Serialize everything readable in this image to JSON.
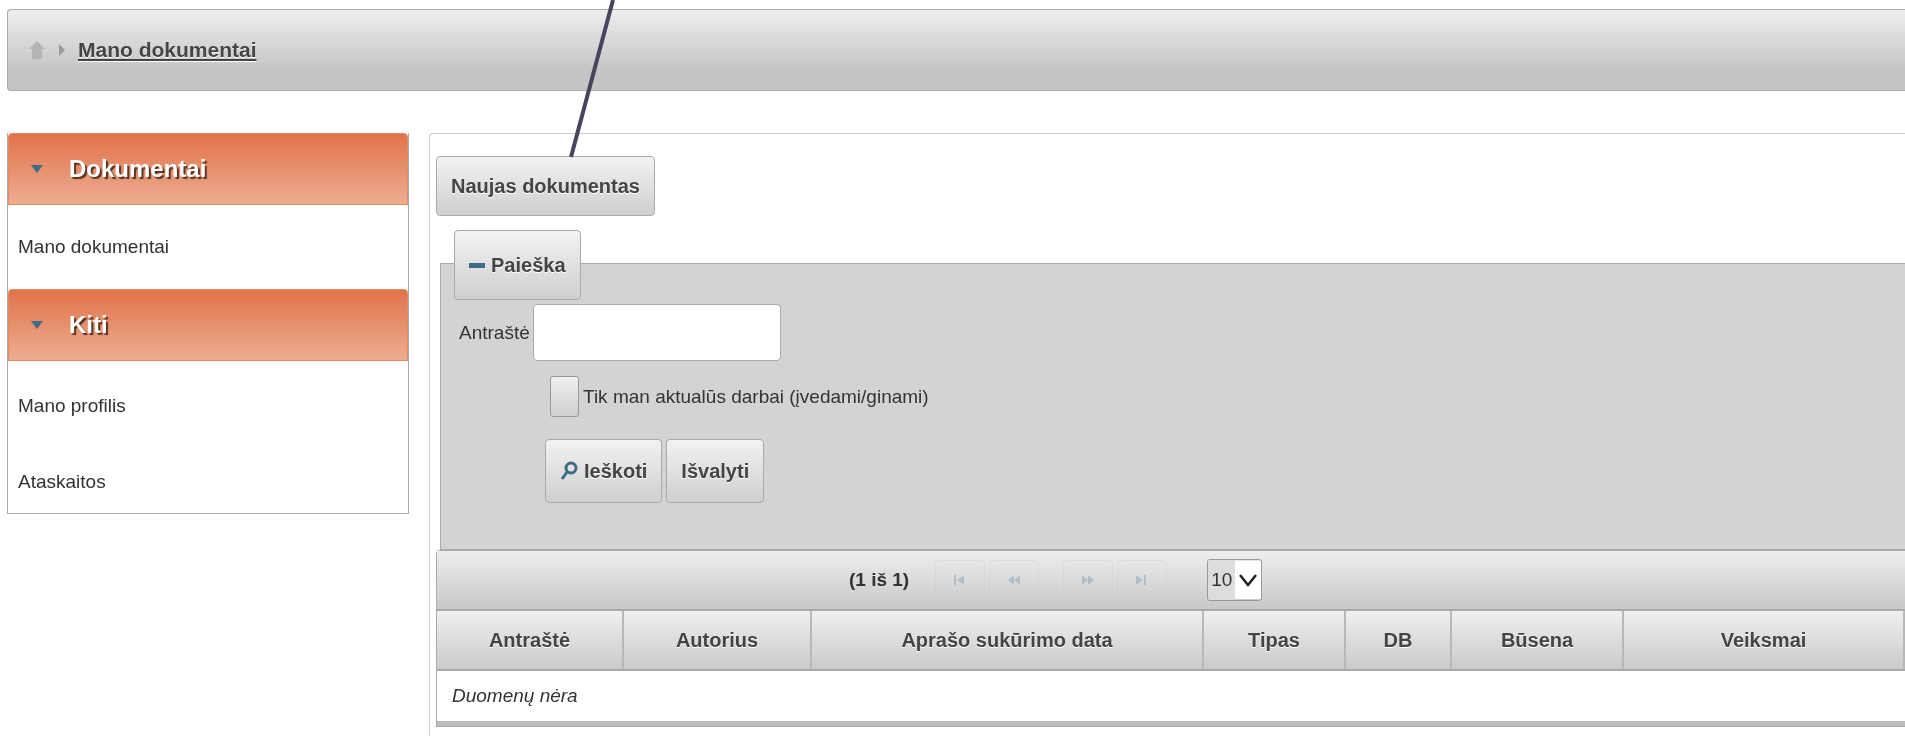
{
  "breadcrumb": {
    "items": [
      "Mano dokumentai"
    ]
  },
  "sidebar": {
    "sections": [
      {
        "title": "Dokumentai",
        "expanded": true,
        "items": [
          "Mano dokumentai"
        ]
      },
      {
        "title": "Kiti",
        "expanded": true,
        "items": [
          "Mano profilis",
          "Ataskaitos"
        ]
      }
    ]
  },
  "new_button": "Naujas dokumentas",
  "search": {
    "legend": "Paieška",
    "expanded": true,
    "field_label": "Antraštė",
    "checkbox": {
      "label": "Tik man aktualūs darbai (įvedami/ginami)",
      "checked": false
    },
    "buttons": [
      {
        "label": "Ieškoti",
        "kind": "search"
      },
      {
        "label": "Išvalyti",
        "kind": "plain"
      }
    ]
  },
  "table": {
    "pager": {
      "text": "(1 iš 1)",
      "page_size": "10",
      "buttons": [
        {
          "kind": "first",
          "disabled": true
        },
        {
          "kind": "prev",
          "disabled": true
        },
        {
          "kind": "next",
          "disabled": true
        },
        {
          "kind": "last",
          "disabled": true
        }
      ]
    },
    "columns": [
      "Antraštė",
      "Autorius",
      "Aprašo sukūrimo data",
      "Tipas",
      "DB",
      "Būsena",
      "Veiksmai"
    ],
    "empty_message": "Duomenų nėra"
  }
}
